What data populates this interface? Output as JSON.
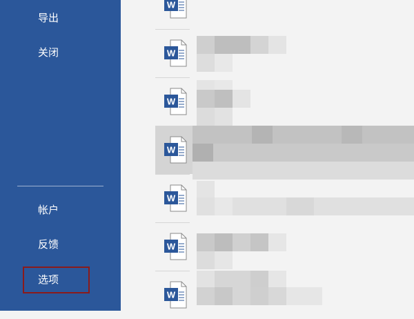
{
  "sidebar": {
    "items_top": [
      {
        "label": "导出"
      },
      {
        "label": "关闭"
      }
    ],
    "items_bottom": [
      {
        "label": "帐户"
      },
      {
        "label": "反馈"
      },
      {
        "label": "选项"
      }
    ],
    "highlight_color": "#8b1a1a",
    "bg_color": "#2b579a"
  },
  "recent_files": {
    "icon": "word-document-icon",
    "accent": "#2b579a",
    "row_count": 7,
    "selected_index": 3,
    "names_obscured": true
  }
}
